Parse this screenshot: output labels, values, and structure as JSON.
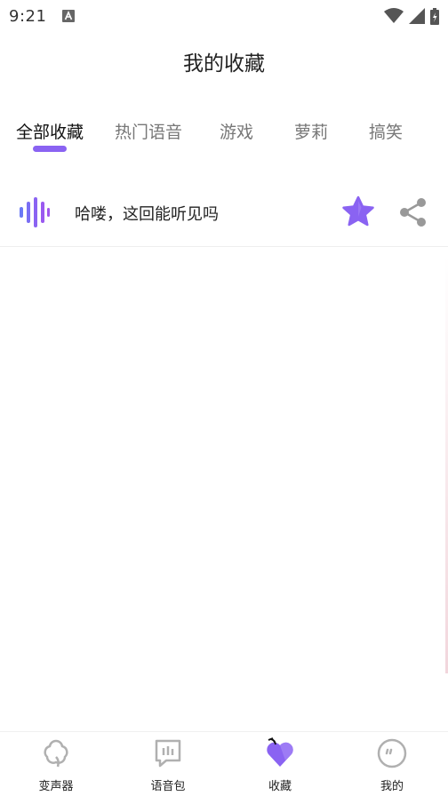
{
  "status_bar": {
    "time": "9:21",
    "icons": [
      "notification-a-icon",
      "wifi-icon",
      "signal-icon",
      "battery-icon"
    ]
  },
  "header": {
    "title": "我的收藏"
  },
  "tabs": {
    "items": [
      {
        "label": "全部收藏",
        "active": true
      },
      {
        "label": "热门语音",
        "active": false
      },
      {
        "label": "游戏",
        "active": false
      },
      {
        "label": "萝莉",
        "active": false
      },
      {
        "label": "搞笑",
        "active": false
      }
    ]
  },
  "favorites": {
    "items": [
      {
        "title": "哈喽，这回能听见吗",
        "icon": "sound-wave-icon",
        "starred": true
      }
    ]
  },
  "bottom_nav": {
    "items": [
      {
        "label": "变声器",
        "icon": "voice-changer-icon",
        "active": false
      },
      {
        "label": "语音包",
        "icon": "voice-pack-icon",
        "active": false
      },
      {
        "label": "收藏",
        "icon": "heart-icon",
        "active": true
      },
      {
        "label": "我的",
        "icon": "profile-icon",
        "active": false
      }
    ]
  },
  "colors": {
    "accent": "#8a63f2",
    "accent_light": "#b59af8",
    "inactive_icon": "#b0b0b0",
    "text_primary": "#222222",
    "text_secondary": "#777777"
  }
}
